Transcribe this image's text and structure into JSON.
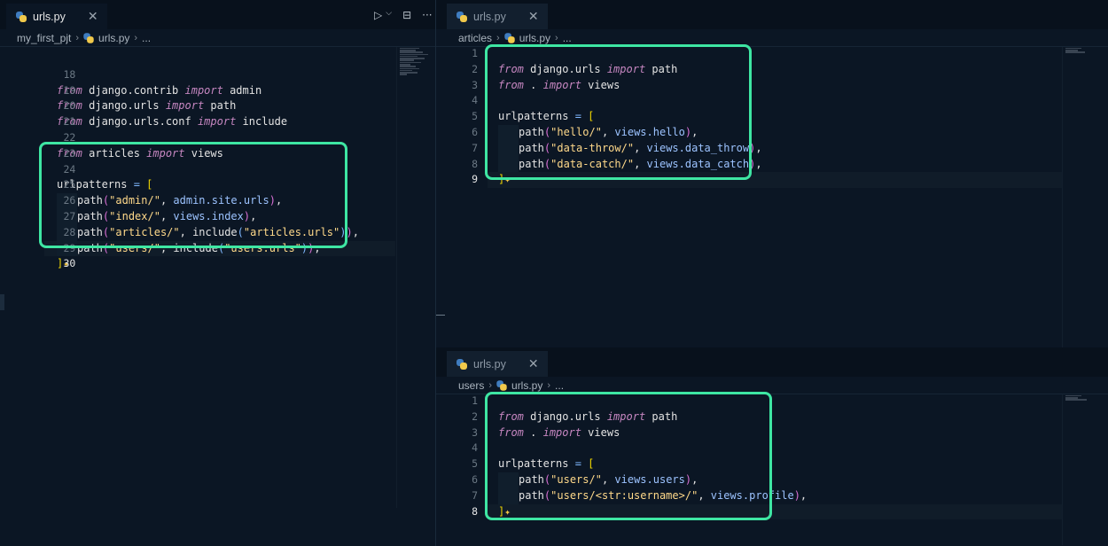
{
  "left": {
    "tab": {
      "label": "urls.py",
      "close": "✕"
    },
    "actions": {
      "run": "▷",
      "run_menu": "⌵",
      "split": "⊟",
      "more": "···"
    },
    "breadcrumb": [
      "my_first_pjt",
      "urls.py",
      "..."
    ],
    "lines": [
      {
        "n": "18",
        "text": "from django.contrib import admin"
      },
      {
        "n": "19",
        "text": "from django.urls import path"
      },
      {
        "n": "20",
        "text": "from django.urls.conf import include"
      },
      {
        "n": "21",
        "text": ""
      },
      {
        "n": "22",
        "text": "from articles import views"
      },
      {
        "n": "23",
        "text": ""
      },
      {
        "n": "24",
        "text": "urlpatterns = ["
      },
      {
        "n": "25",
        "text": "path(\"admin/\", admin.site.urls),"
      },
      {
        "n": "26",
        "text": "path(\"index/\", views.index),"
      },
      {
        "n": "27",
        "text": "path(\"articles/\", include(\"articles.urls\")),"
      },
      {
        "n": "28",
        "text": "path(\"users/\", include(\"users.urls\")),"
      },
      {
        "n": "29",
        "text": "]"
      },
      {
        "n": "30",
        "text": ""
      }
    ]
  },
  "top_right": {
    "tab": {
      "label": "urls.py",
      "close": "✕"
    },
    "breadcrumb": [
      "articles",
      "urls.py",
      "..."
    ],
    "lines": [
      {
        "n": "1",
        "text": "from django.urls import path"
      },
      {
        "n": "2",
        "text": "from . import views"
      },
      {
        "n": "3",
        "text": ""
      },
      {
        "n": "4",
        "text": "urlpatterns = ["
      },
      {
        "n": "5",
        "text": "path(\"hello/\", views.hello),"
      },
      {
        "n": "6",
        "text": "path(\"data-throw/\", views.data_throw),"
      },
      {
        "n": "7",
        "text": "path(\"data-catch/\", views.data_catch),"
      },
      {
        "n": "8",
        "text": "]"
      },
      {
        "n": "9",
        "text": ""
      }
    ]
  },
  "bottom_right": {
    "tab": {
      "label": "urls.py",
      "close": "✕"
    },
    "breadcrumb": [
      "users",
      "urls.py",
      "..."
    ],
    "lines": [
      {
        "n": "1",
        "text": "from django.urls import path"
      },
      {
        "n": "2",
        "text": "from . import views"
      },
      {
        "n": "3",
        "text": ""
      },
      {
        "n": "4",
        "text": "urlpatterns = ["
      },
      {
        "n": "5",
        "text": "path(\"users/\", views.users),"
      },
      {
        "n": "6",
        "text": "path(\"users/<str:username>/\", views.profile),"
      },
      {
        "n": "7",
        "text": "]"
      },
      {
        "n": "8",
        "text": ""
      }
    ]
  },
  "colors": {
    "highlight_box": "#3ee6a3",
    "keyword": "#c586c0",
    "string": "#ffd98a",
    "attribute": "#9cc3ff",
    "bracket": "#f1d700"
  },
  "icons": {
    "file": "python-icon",
    "sparkle": "sparkle-icon"
  }
}
